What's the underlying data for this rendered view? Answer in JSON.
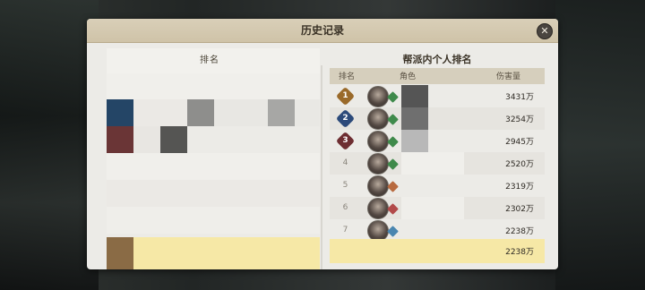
{
  "dialog": {
    "title": "历史记录",
    "close_label": "✕"
  },
  "left_panel": {
    "header_label": "排名"
  },
  "right_panel": {
    "title": "帮派内个人排名",
    "columns": {
      "rank": "排名",
      "role": "角色",
      "damage": "伤害量"
    },
    "rows": [
      {
        "rank": "1",
        "damage": "3431万",
        "badge_color": "#9a6a2a",
        "class_color": "#3f8a4b"
      },
      {
        "rank": "2",
        "damage": "3254万",
        "badge_color": "#2c4a7a",
        "class_color": "#3f8a4b"
      },
      {
        "rank": "3",
        "damage": "2945万",
        "badge_color": "#6e2e32",
        "class_color": "#3f8a4b"
      },
      {
        "rank": "4",
        "damage": "2520万",
        "badge_color": "",
        "class_color": "#3f8a4b"
      },
      {
        "rank": "5",
        "damage": "2319万",
        "badge_color": "",
        "class_color": "#b86a3f"
      },
      {
        "rank": "6",
        "damage": "2302万",
        "badge_color": "",
        "class_color": "#b24a4a"
      },
      {
        "rank": "7",
        "damage": "2238万",
        "badge_color": "",
        "class_color": "#4a86b0"
      }
    ],
    "self_row": {
      "damage": "2238万"
    }
  },
  "colors": {
    "dialog_bg": "#ecebe7",
    "header_bg": "#d9cfb8",
    "self_highlight": "#f6e8a6"
  }
}
